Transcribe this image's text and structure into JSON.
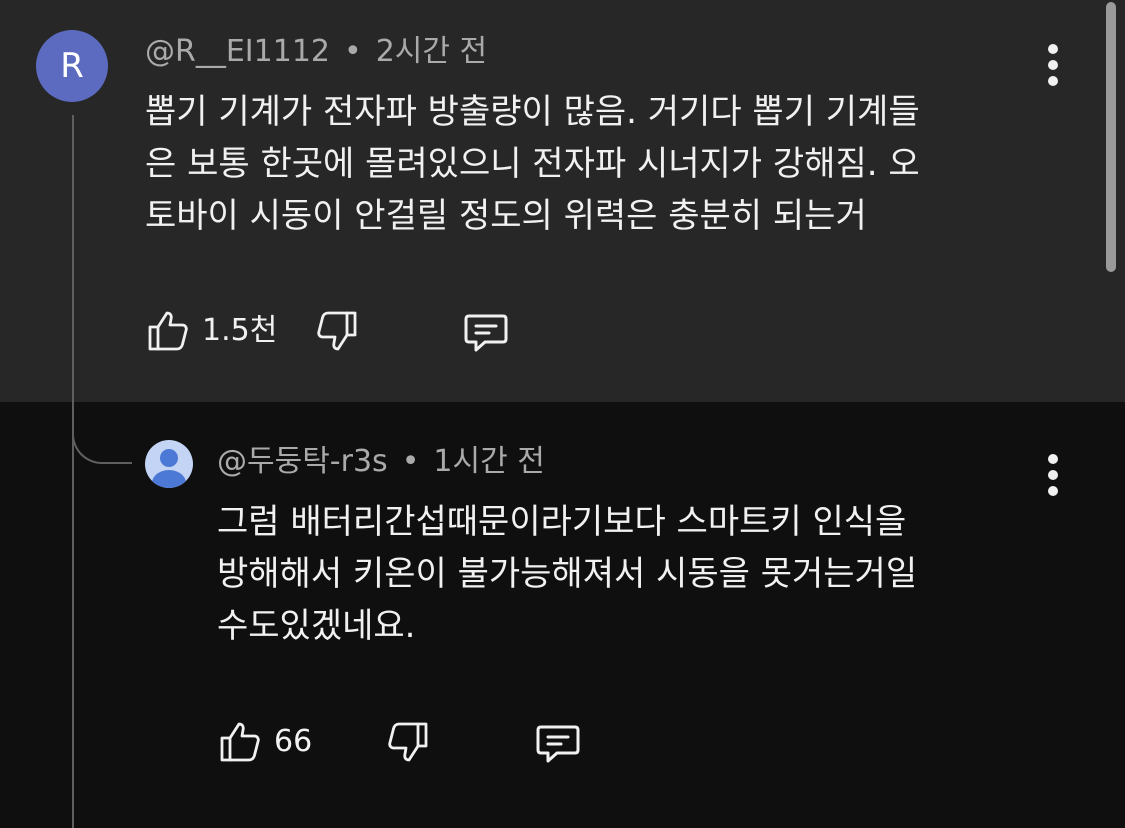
{
  "comment": {
    "avatar_letter": "R",
    "author": "@R__EI1112",
    "separator": "•",
    "time": "2시간 전",
    "lines": [
      "뽑기 기계가 전자파 방출량이 많음. 거기다 뽑기 기계들",
      "은 보통 한곳에 몰려있으니 전자파 시너지가 강해짐. 오",
      "토바이 시동이 안걸릴 정도의 위력은 충분히 되는거"
    ],
    "like_count": "1.5천"
  },
  "reply": {
    "author": "@두둥탁-r3s",
    "separator": "•",
    "time": "1시간 전",
    "lines": [
      "그럼 배터리간섭때문이라기보다 스마트키 인식을",
      "방해해서 키온이 불가능해져서 시동을 못거는거일",
      "수도있겠네요."
    ],
    "like_count": "66"
  },
  "colors": {
    "highlight_bg": "#272727",
    "page_bg": "#0f0f0f",
    "avatar_r": "#5c6bc0",
    "meta_text": "#aaaaaa",
    "body_text": "#f1f1f1"
  },
  "icons": [
    "thumbs-up-icon",
    "thumbs-down-icon",
    "reply-icon",
    "more-vert-icon",
    "default-avatar-icon"
  ]
}
